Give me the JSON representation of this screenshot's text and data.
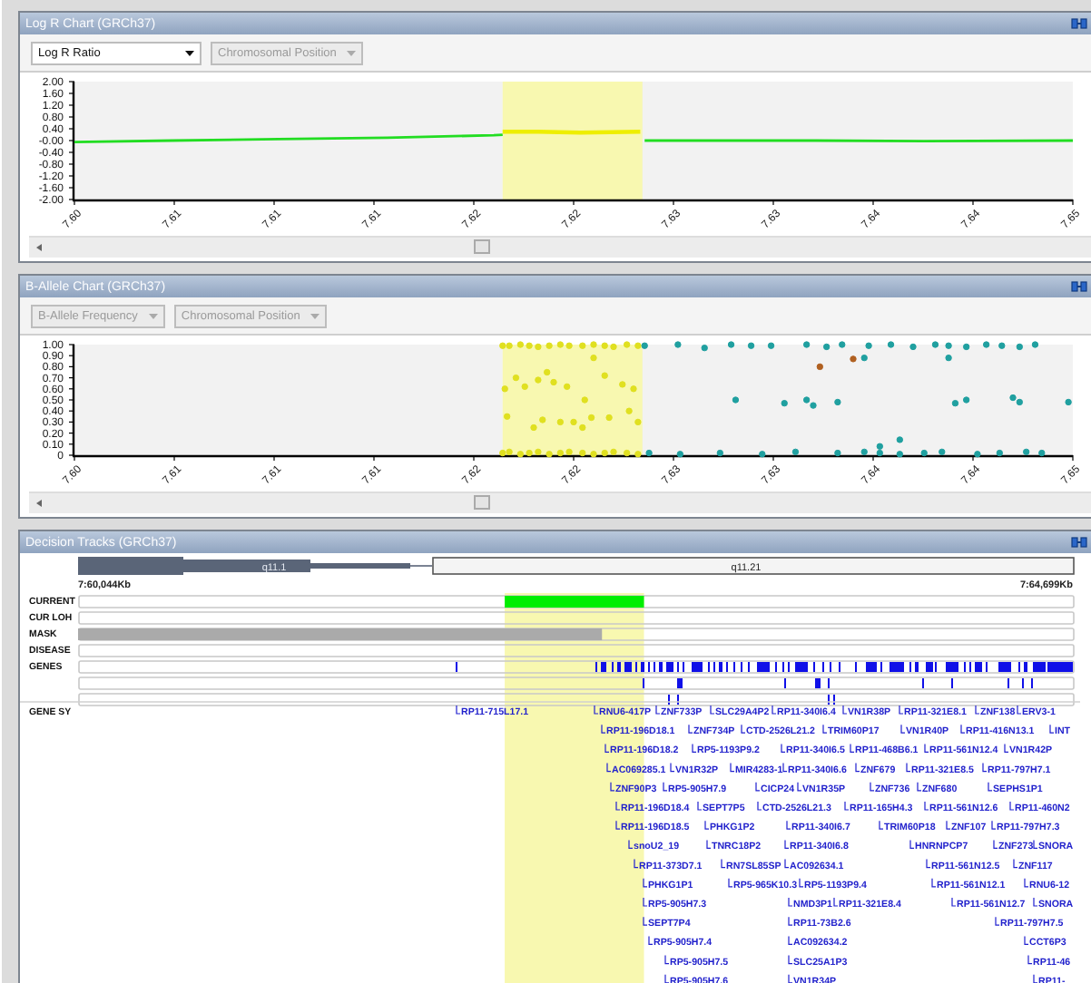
{
  "log_r_chart": {
    "title": "Log R Chart (GRCh37)",
    "controls": [
      {
        "label": "Log R Ratio",
        "disabled": false
      },
      {
        "label": "Chromosomal Position",
        "disabled": true
      }
    ],
    "chart_data": {
      "type": "line",
      "xlim": [
        7.601,
        7.646
      ],
      "ylim": [
        -2,
        2
      ],
      "bands": [
        {
          "axis": "x",
          "from": 7.6203,
          "to": 7.6266,
          "color": "#f8f8b0"
        }
      ],
      "yticks": [
        {
          "value": 2,
          "label": "2.00"
        },
        {
          "value": 1.6,
          "label": "1.60"
        },
        {
          "value": 1.2,
          "label": "1.20"
        },
        {
          "value": 0.8,
          "label": "0.80"
        },
        {
          "value": 0.4,
          "label": "0.40"
        },
        {
          "value": 0,
          "label": "-0.00"
        },
        {
          "value": -0.4,
          "label": "-0.40"
        },
        {
          "value": -0.8,
          "label": "-0.80"
        },
        {
          "value": -1.2,
          "label": "-1.20"
        },
        {
          "value": -1.6,
          "label": "-1.60"
        },
        {
          "value": -2,
          "label": "-2.00"
        }
      ],
      "xticks": [
        {
          "value": 7.601,
          "label": "7.60"
        },
        {
          "value": 7.6055,
          "label": "7.61"
        },
        {
          "value": 7.61,
          "label": "7.61"
        },
        {
          "value": 7.6145,
          "label": "7.61"
        },
        {
          "value": 7.619,
          "label": "7.62"
        },
        {
          "value": 7.6235,
          "label": "7.62"
        },
        {
          "value": 7.628,
          "label": "7.63"
        },
        {
          "value": 7.6325,
          "label": "7.63"
        },
        {
          "value": 7.637,
          "label": "7.64"
        },
        {
          "value": 7.6415,
          "label": "7.64"
        },
        {
          "value": 7.646,
          "label": "7.65"
        }
      ],
      "x": [
        7.601,
        7.6054,
        7.6102,
        7.6151,
        7.6199,
        7.6203,
        7.6219,
        7.6238,
        7.6265,
        7.6267,
        7.6296,
        7.6344,
        7.6393,
        7.646
      ],
      "series": [
        {
          "color": "#22dd22",
          "values": [
            -0.05,
            0.0,
            0.05,
            0.1,
            0.18,
            0.2,
            null,
            null,
            null,
            0.0,
            0.0,
            0.0,
            -0.02,
            0.0
          ]
        },
        {
          "color": "#eeee00",
          "values": [
            null,
            null,
            null,
            null,
            null,
            0.3,
            0.3,
            0.27,
            0.3,
            null,
            null,
            null,
            null,
            null
          ]
        }
      ]
    }
  },
  "b_allele_chart": {
    "title": "B-Allele Chart (GRCh37)",
    "controls": [
      {
        "label": "B-Allele Frequency",
        "disabled": true
      },
      {
        "label": "Chromosomal Position",
        "disabled": true
      }
    ],
    "chart_data": {
      "type": "scatter",
      "xlim": [
        7.601,
        7.646
      ],
      "ylim": [
        0,
        1
      ],
      "bands": [
        {
          "axis": "x",
          "from": 7.6203,
          "to": 7.6266,
          "color": "#f8f8b0"
        }
      ],
      "yticks": [
        {
          "value": 1,
          "label": "1.00"
        },
        {
          "value": 0.9,
          "label": "0.90"
        },
        {
          "value": 0.8,
          "label": "0.80"
        },
        {
          "value": 0.7,
          "label": "0.70"
        },
        {
          "value": 0.6,
          "label": "0.60"
        },
        {
          "value": 0.5,
          "label": "0.50"
        },
        {
          "value": 0.4,
          "label": "0.40"
        },
        {
          "value": 0.3,
          "label": "0.30"
        },
        {
          "value": 0.2,
          "label": "0.20"
        },
        {
          "value": 0.1,
          "label": "0.10"
        },
        {
          "value": 0,
          "label": "0"
        }
      ],
      "xticks": [
        {
          "value": 7.601,
          "label": "7.60"
        },
        {
          "value": 7.6055,
          "label": "7.61"
        },
        {
          "value": 7.61,
          "label": "7.61"
        },
        {
          "value": 7.6145,
          "label": "7.61"
        },
        {
          "value": 7.619,
          "label": "7.62"
        },
        {
          "value": 7.6235,
          "label": "7.62"
        },
        {
          "value": 7.628,
          "label": "7.63"
        },
        {
          "value": 7.6325,
          "label": "7.63"
        },
        {
          "value": 7.637,
          "label": "7.64"
        },
        {
          "value": 7.6415,
          "label": "7.64"
        },
        {
          "value": 7.646,
          "label": "7.65"
        }
      ],
      "series": [
        {
          "color": "#e0e020",
          "x": [
            7.6203,
            7.6206,
            7.6211,
            7.6215,
            7.6219,
            7.6224,
            7.6229,
            7.6233,
            7.6239,
            7.6244,
            7.6249,
            7.6253,
            7.6259,
            7.6264,
            7.6203,
            7.6206,
            7.6211,
            7.6215,
            7.6219,
            7.6224,
            7.6229,
            7.6233,
            7.6239,
            7.6244,
            7.6249,
            7.6253,
            7.6259,
            7.6264,
            7.6204,
            7.6209,
            7.6205,
            7.6213,
            7.6219,
            7.6223,
            7.6226,
            7.6232,
            7.6221,
            7.6229,
            7.6235,
            7.624,
            7.6244,
            7.6249,
            7.6243,
            7.6251,
            7.6257,
            7.626,
            7.6264,
            7.6262,
            7.6217,
            7.6239
          ],
          "values": [
            0.99,
            0.99,
            1.0,
            0.99,
            0.98,
            0.99,
            1.0,
            0.99,
            0.99,
            1.0,
            0.99,
            0.98,
            1.0,
            0.99,
            0.02,
            0.03,
            0.01,
            0.02,
            0.03,
            0.01,
            0.02,
            0.03,
            0.02,
            0.01,
            0.02,
            0.03,
            0.02,
            0.01,
            0.6,
            0.7,
            0.35,
            0.62,
            0.68,
            0.75,
            0.66,
            0.62,
            0.32,
            0.3,
            0.3,
            0.5,
            0.88,
            0.72,
            0.34,
            0.34,
            0.64,
            0.4,
            0.3,
            0.6,
            0.25,
            0.25
          ]
        },
        {
          "color": "#20a0a0",
          "x": [
            7.6267,
            7.6282,
            7.6294,
            7.6306,
            7.6315,
            7.6324,
            7.634,
            7.6349,
            7.6356,
            7.6368,
            7.6378,
            7.6388,
            7.6398,
            7.6404,
            7.6412,
            7.6421,
            7.6428,
            7.6436,
            7.6443,
            7.6269,
            7.6283,
            7.6301,
            7.632,
            7.6335,
            7.6354,
            7.6366,
            7.6373,
            7.6382,
            7.6393,
            7.6401,
            7.6417,
            7.6427,
            7.6439,
            7.6446,
            7.6308,
            7.633,
            7.634,
            7.6343,
            7.6354,
            7.6407,
            7.6412,
            7.6433,
            7.6436,
            7.6458,
            7.6373,
            7.6382,
            7.6404,
            7.6366
          ],
          "values": [
            0.99,
            1.0,
            0.97,
            1.0,
            0.99,
            0.99,
            1.0,
            0.98,
            1.0,
            0.99,
            1.0,
            0.98,
            1.0,
            0.99,
            0.98,
            1.0,
            0.99,
            0.98,
            1.0,
            0.02,
            0.01,
            0.02,
            0.01,
            0.03,
            0.02,
            0.03,
            0.02,
            0.01,
            0.02,
            0.03,
            0.01,
            0.02,
            0.03,
            0.02,
            0.5,
            0.47,
            0.5,
            0.45,
            0.48,
            0.47,
            0.5,
            0.52,
            0.48,
            0.48,
            0.08,
            0.14,
            0.88,
            0.88
          ]
        },
        {
          "color": "#b06020",
          "x": [
            7.6346,
            7.6361
          ],
          "values": [
            0.8,
            0.87
          ]
        }
      ]
    }
  },
  "decision_tracks": {
    "title": "Decision Tracks (GRCh37)",
    "ideogram": {
      "bands": [
        {
          "name": "q11.1",
          "kind": "centromere"
        },
        {
          "name": "q11.21",
          "kind": "band"
        }
      ],
      "start_label": "7:60,044Kb",
      "end_label": "7:64,699Kb"
    },
    "tracks": [
      {
        "label": "CURRENT",
        "kind": "segments",
        "segments": [
          {
            "color": "#00ee00"
          }
        ]
      },
      {
        "label": "CUR LOH",
        "kind": "segments"
      },
      {
        "label": "MASK",
        "kind": "segments",
        "segments": [
          {
            "color": "#aaaaaa"
          }
        ]
      },
      {
        "label": "DISEASE",
        "kind": "segments"
      },
      {
        "label": "GENES",
        "kind": "genes"
      },
      {
        "kind": "genes"
      },
      {
        "kind": "genes"
      }
    ],
    "gene_symbols": {
      "label": "GENE SY",
      "genes": [
        "RP11-715L17.1",
        "RNU6-417P",
        "ZNF733P",
        "SLC29A4P2",
        "RP11-340I6.4",
        "VN1R38P",
        "RP11-321E8.1",
        "ZNF138",
        "ERV3-1",
        "RP11-196D18.1",
        "ZNF734P",
        "CTD-2526L21.2",
        "TRIM60P17",
        "VN1R40P",
        "RP11-416N13.1",
        "INT",
        "RP11-196D18.2",
        "RP5-1193P9.2",
        "RP11-340I6.5",
        "RP11-468B6.1",
        "RP11-561N12.4",
        "VN1R42P",
        "AC069285.1",
        "VN1R32P",
        "MIR4283-1",
        "RP11-340I6.6",
        "ZNF679",
        "RP11-321E8.5",
        "RP11-797H7.1",
        "ZNF90P3",
        "RP5-905H7.9",
        "CICP24",
        "VN1R35P",
        "ZNF736",
        "ZNF680",
        "SEPHS1P1",
        "RP11-196D18.4",
        "SEPT7P5",
        "CTD-2526L21.3",
        "RP11-165H4.3",
        "RP11-561N12.6",
        "RP11-460N2",
        "RP11-196D18.5",
        "PHKG1P2",
        "RP11-340I6.7",
        "TRIM60P18",
        "ZNF107",
        "RP11-797H7.3",
        "snoU2_19",
        "TNRC18P2",
        "RP11-340I6.8",
        "HNRNPCP7",
        "ZNF273",
        "SNORA",
        "RP11-373D7.1",
        "RN7SL85SP",
        "AC092634.1",
        "RP11-561N12.5",
        "ZNF117",
        "PHKG1P1",
        "RP5-965K10.3",
        "RP5-1193P9.4",
        "RP11-561N12.1",
        "RNU6-12",
        "RP5-905H7.3",
        "NMD3P1",
        "RP11-321E8.4",
        "RP11-561N12.7",
        "SNORA",
        "SEPT7P4",
        "RP11-73B2.6",
        "RP11-797H7.5",
        "RP5-905H7.4",
        "AC092634.2",
        "CCT6P3",
        "RP5-905H7.5",
        "SLC25A1P3",
        "RP11-46",
        "RP5-905H7.6",
        "VN1R34P",
        "RP11-"
      ]
    }
  }
}
